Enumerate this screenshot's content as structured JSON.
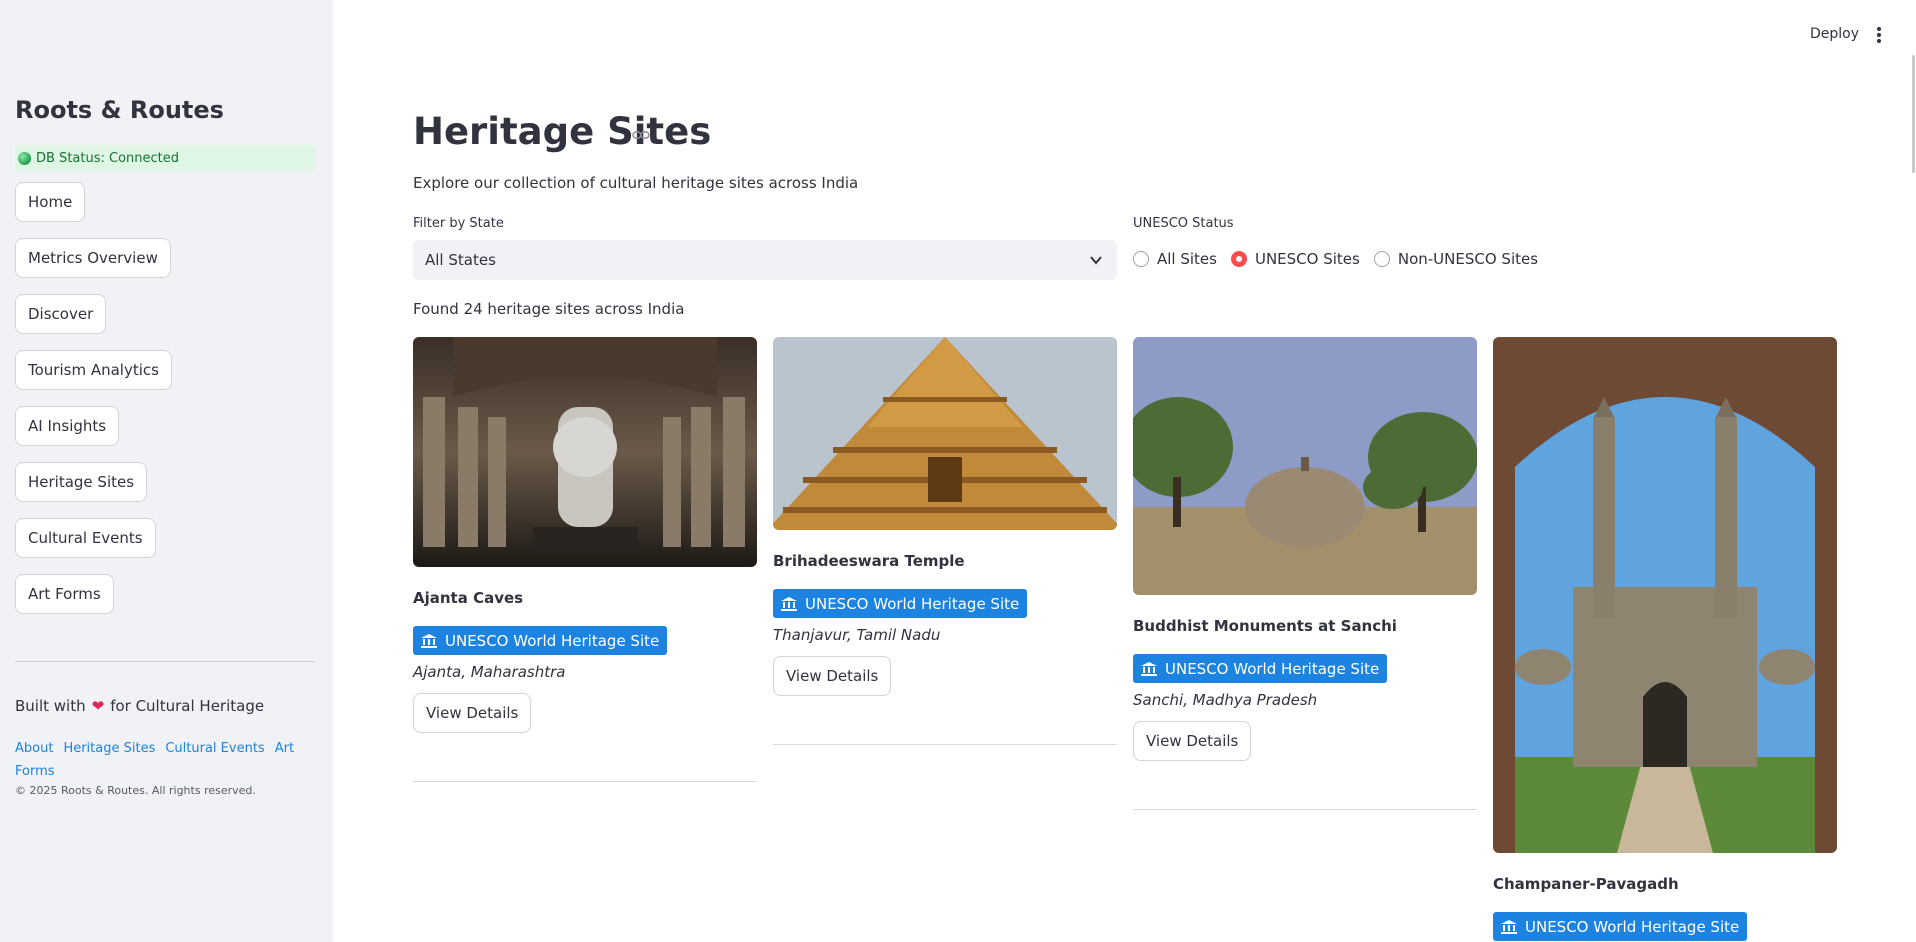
{
  "sidebar": {
    "app_title": "Roots & Routes",
    "db_status": "DB Status: Connected",
    "nav": [
      {
        "label": "Home"
      },
      {
        "label": "Metrics Overview"
      },
      {
        "label": "Discover"
      },
      {
        "label": "Tourism Analytics"
      },
      {
        "label": "AI Insights"
      },
      {
        "label": "Heritage Sites"
      },
      {
        "label": "Cultural Events"
      },
      {
        "label": "Art Forms"
      }
    ],
    "built_with_prefix": "Built with",
    "built_with_suffix": "for Cultural Heritage",
    "footer_links": [
      "About",
      "Heritage Sites",
      "Cultural Events",
      "Art Forms"
    ],
    "copyright": "© 2025 Roots & Routes. All rights reserved."
  },
  "header": {
    "deploy_label": "Deploy"
  },
  "main": {
    "title": "Heritage Sites",
    "subtitle": "Explore our collection of cultural heritage sites across India",
    "filter_state": {
      "label": "Filter by State",
      "selected": "All States"
    },
    "unesco_filter": {
      "label": "UNESCO Status",
      "options": [
        {
          "label": "All Sites",
          "checked": false
        },
        {
          "label": "UNESCO Sites",
          "checked": true
        },
        {
          "label": "Non-UNESCO Sites",
          "checked": false
        }
      ]
    },
    "found_text": "Found 24 heritage sites across India",
    "cards": [
      {
        "name": "Ajanta Caves",
        "badge": "UNESCO World Heritage Site",
        "location": "Ajanta, Maharashtra",
        "button": "View Details"
      },
      {
        "name": "Brihadeeswara Temple",
        "badge": "UNESCO World Heritage Site",
        "location": "Thanjavur, Tamil Nadu",
        "button": "View Details"
      },
      {
        "name": "Buddhist Monuments at Sanchi",
        "badge": "UNESCO World Heritage Site",
        "location": "Sanchi, Madhya Pradesh",
        "button": "View Details"
      },
      {
        "name": "Champaner-Pavagadh",
        "badge": "UNESCO World Heritage Site",
        "location": "",
        "button": ""
      }
    ]
  },
  "colors": {
    "accent": "#1c83e1",
    "radio_selected": "#ff4b4b",
    "sidebar_bg": "#f0f2f6",
    "status_bg": "#dff6e4",
    "status_text": "#177233"
  }
}
